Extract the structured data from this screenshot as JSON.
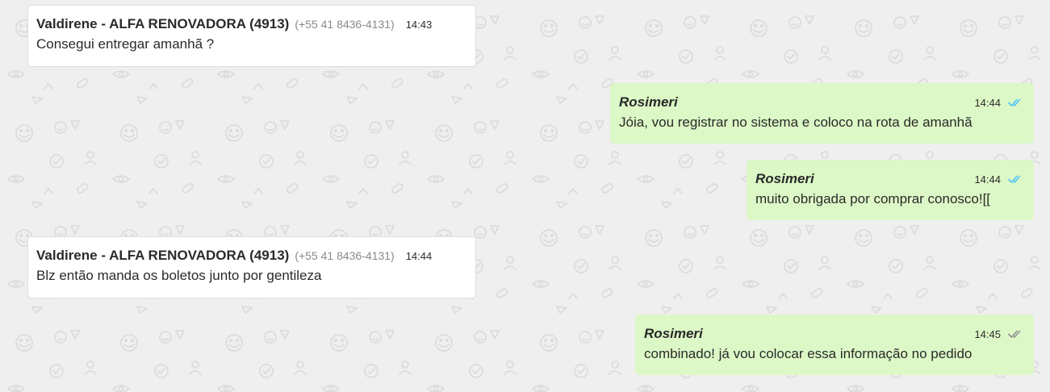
{
  "colors": {
    "background": "#efefef",
    "incoming_bubble": "#ffffff",
    "outgoing_bubble": "#dcf8c6",
    "read_ticks": "#4fc3f7",
    "sent_ticks": "#8f8f8f"
  },
  "messages": [
    {
      "direction": "incoming",
      "sender": "Valdirene - ALFA RENOVADORA (4913)",
      "phone": "(+55 41 8436-4131)",
      "time": "14:43",
      "text": "Consegui entregar amanhã ?"
    },
    {
      "direction": "outgoing",
      "sender": "Rosimeri",
      "time": "14:44",
      "status": "read",
      "text": "Jóia, vou registrar no sistema e coloco na rota de amanhã"
    },
    {
      "direction": "outgoing",
      "sender": "Rosimeri",
      "time": "14:44",
      "status": "read",
      "text": "muito obrigada por comprar conosco![["
    },
    {
      "direction": "incoming",
      "sender": "Valdirene - ALFA RENOVADORA (4913)",
      "phone": "(+55 41 8436-4131)",
      "time": "14:44",
      "text": "Blz então manda os boletos junto por gentileza"
    },
    {
      "direction": "outgoing",
      "sender": "Rosimeri",
      "time": "14:45",
      "status": "delivered",
      "text": "combinado! já vou colocar essa informação no pedido"
    }
  ]
}
